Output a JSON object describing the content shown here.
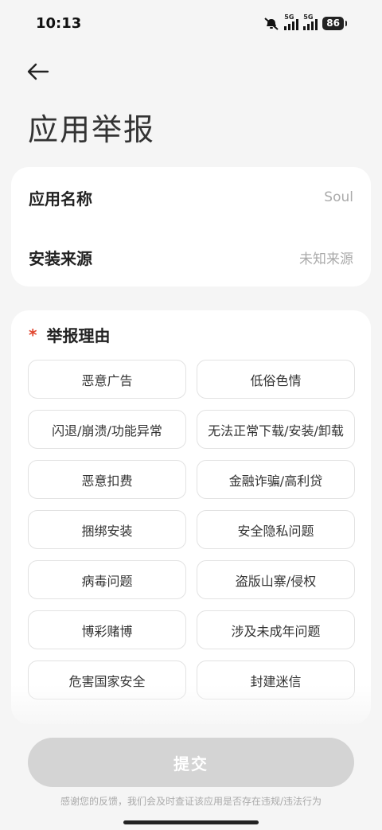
{
  "status_bar": {
    "time": "10:13",
    "network_1": "5G",
    "network_2": "5G",
    "battery": "86"
  },
  "header": {
    "back_icon": "arrow-left-icon",
    "title": "应用举报"
  },
  "app_info": {
    "name_label": "应用名称",
    "name_value": "Soul",
    "source_label": "安装来源",
    "source_value": "未知来源"
  },
  "reason": {
    "required_mark": "*",
    "title": "举报理由",
    "options": [
      "恶意广告",
      "低俗色情",
      "闪退/崩溃/功能异常",
      "无法正常下载/安装/卸载",
      "恶意扣费",
      "金融诈骗/高利贷",
      "捆绑安装",
      "安全隐私问题",
      "病毒问题",
      "盗版山寨/侵权",
      "博彩赌博",
      "涉及未成年问题",
      "危害国家安全",
      "封建迷信"
    ]
  },
  "submit": {
    "label": "提交",
    "note": "感谢您的反馈，我们会及时查证该应用是否存在违规/违法行为"
  },
  "colors": {
    "background": "#f5f5f5",
    "card": "#ffffff",
    "required": "#e0442d",
    "submit_disabled": "#d4d4d4"
  }
}
